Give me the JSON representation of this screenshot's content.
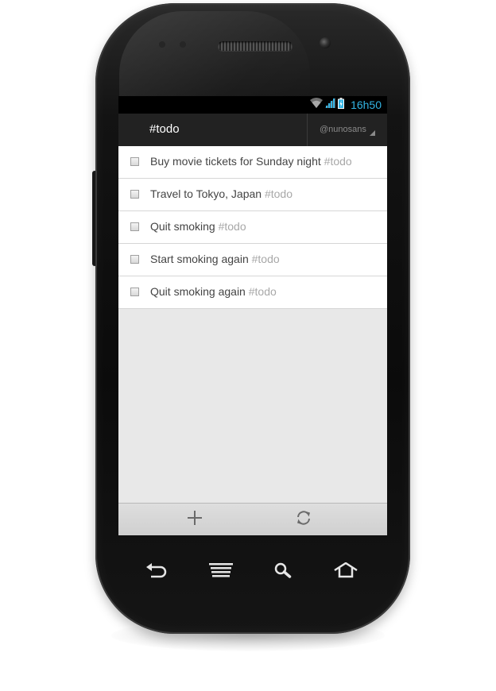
{
  "status_bar": {
    "time": "16h50",
    "icons": [
      "wifi-icon",
      "signal-icon",
      "battery-charging-icon"
    ],
    "accent_color": "#33b5e5"
  },
  "action_bar": {
    "title": "#todo",
    "account": "@nunosans"
  },
  "todos": [
    {
      "text": "Buy movie tickets for Sunday night",
      "tag": "#todo",
      "checked": false
    },
    {
      "text": "Travel to Tokyo, Japan",
      "tag": "#todo",
      "checked": false
    },
    {
      "text": "Quit smoking",
      "tag": "#todo",
      "checked": false
    },
    {
      "text": "Start smoking again",
      "tag": "#todo",
      "checked": false
    },
    {
      "text": "Quit smoking again",
      "tag": "#todo",
      "checked": false
    }
  ],
  "bottom_bar": {
    "actions": [
      "plus-icon",
      "refresh-icon"
    ]
  },
  "nav_keys": [
    "back-icon",
    "menu-icon",
    "search-icon",
    "home-icon"
  ],
  "colors": {
    "action_bar": "#222222",
    "list_background": "#ffffff",
    "empty_area": "#e8e8e8",
    "tag_text": "#a8a8a8"
  }
}
